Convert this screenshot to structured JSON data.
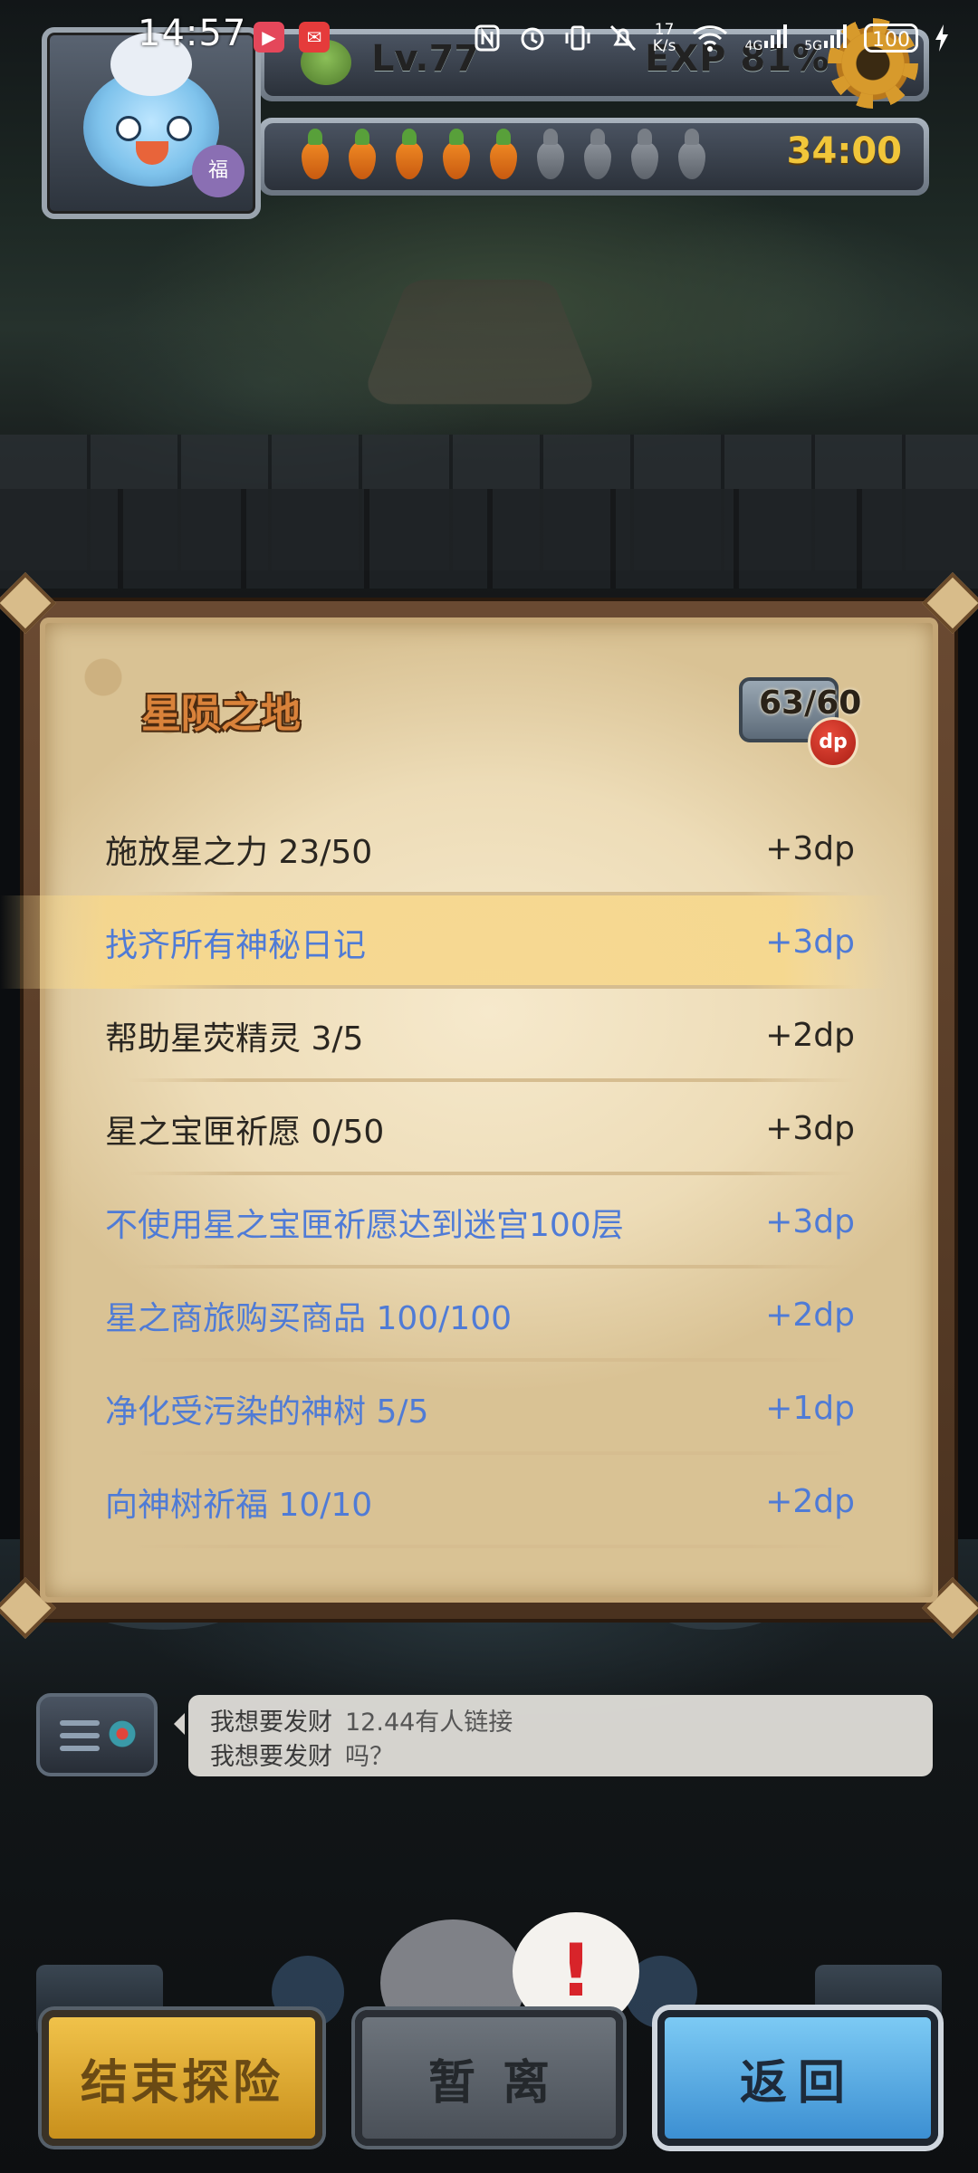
{
  "status_bar": {
    "time": "14:57",
    "net_speed_value": "17",
    "net_speed_unit": "K/s",
    "signal_1": "4G",
    "signal_2": "5G",
    "battery": "100"
  },
  "player": {
    "avatar_badge": "福",
    "level": "Lv.77",
    "exp": "EXP 81%",
    "stamina_full": 5,
    "stamina_total": 9,
    "timer": "34:00"
  },
  "panel": {
    "title": "星陨之地",
    "chest_count": "63/60",
    "badge": "dp",
    "quests": [
      {
        "text": "施放星之力 23/50",
        "points": "+3dp",
        "completed": false,
        "highlighted": false
      },
      {
        "text": "找齐所有神秘日记",
        "points": "+3dp",
        "completed": true,
        "highlighted": true
      },
      {
        "text": "帮助星荧精灵 3/5",
        "points": "+2dp",
        "completed": false,
        "highlighted": false
      },
      {
        "text": "星之宝匣祈愿 0/50",
        "points": "+3dp",
        "completed": false,
        "highlighted": false
      },
      {
        "text": "不使用星之宝匣祈愿达到迷宫100层",
        "points": "+3dp",
        "completed": true,
        "highlighted": false
      },
      {
        "text": "星之商旅购买商品 100/100",
        "points": "+2dp",
        "completed": true,
        "highlighted": false
      },
      {
        "text": "净化受污染的神树 5/5",
        "points": "+1dp",
        "completed": true,
        "highlighted": false
      },
      {
        "text": "向神树祈福 10/10",
        "points": "+2dp",
        "completed": true,
        "highlighted": false
      }
    ]
  },
  "chat": {
    "messages": [
      {
        "user": "我想要发财",
        "text": "12.44有人链接"
      },
      {
        "user": "我想要发财",
        "text": "吗？"
      }
    ]
  },
  "bottom": {
    "alert": "!",
    "end_label": "结束探险",
    "leave_label": "暂离",
    "back_label": "返回"
  },
  "colors": {
    "completed_text": "#4f7bd6",
    "pending_text": "#2a2620",
    "title": "#d9823a",
    "timer": "#f1c63a"
  }
}
